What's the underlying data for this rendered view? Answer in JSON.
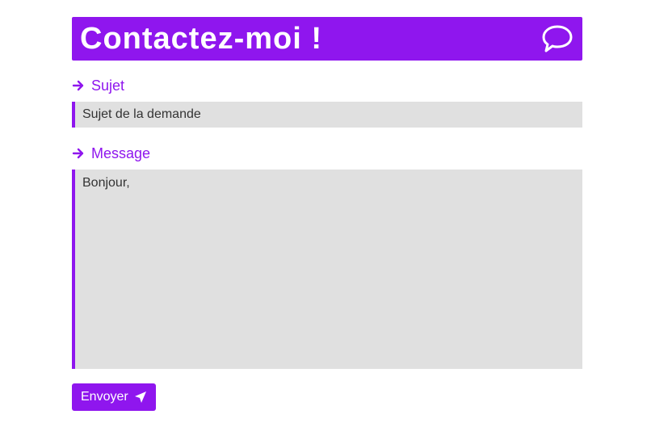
{
  "header": {
    "title": "Contactez-moi !",
    "icon": "speech-bubble-icon"
  },
  "subject": {
    "label": "Sujet",
    "value": "Sujet de la demande",
    "icon": "arrow-right-icon"
  },
  "message": {
    "label": "Message",
    "value": "Bonjour,",
    "icon": "arrow-right-icon"
  },
  "send_button": {
    "label": "Envoyer",
    "icon": "paper-plane-icon"
  },
  "colors": {
    "accent": "#8f16ee",
    "field_bg": "#e0e0e0",
    "text": "#333333"
  }
}
